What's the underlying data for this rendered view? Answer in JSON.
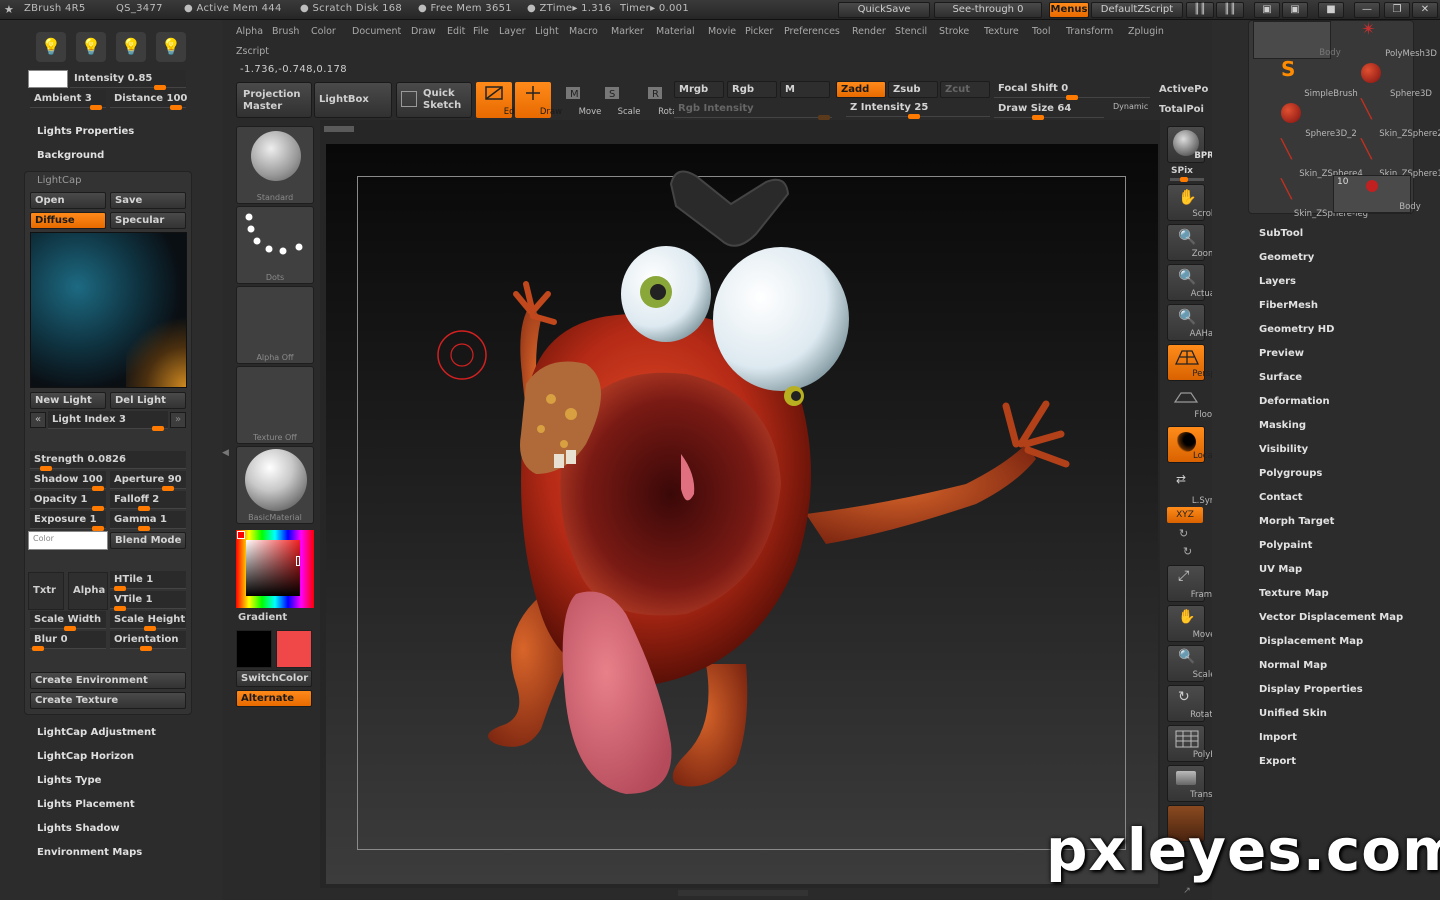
{
  "titlebar": {
    "app": "ZBrush 4R5",
    "project": "QS_3477",
    "active_mem": "● Active Mem 444",
    "scratch_disk": "● Scratch Disk 168",
    "free_mem": "● Free Mem 3651",
    "ztime": "● ZTime▸ 1.316",
    "timer": "Timer▸ 0.001",
    "quicksave": "QuickSave",
    "see_through": "See-through  0",
    "menus": "Menus",
    "default_zscript": "DefaultZScript"
  },
  "menus": [
    "Alpha",
    "Brush",
    "Color",
    "Document",
    "Draw",
    "Edit",
    "File",
    "Layer",
    "Light",
    "Macro",
    "Marker",
    "Material",
    "Movie",
    "Picker",
    "Preferences",
    "Render",
    "Stencil",
    "Stroke",
    "Texture",
    "Tool",
    "Transform",
    "Zplugin"
  ],
  "zscript_label": "Zscript",
  "coords": "-1.736,-0.748,0.178",
  "toolbar": {
    "projection_master": "Projection Master",
    "lightbox": "LightBox",
    "quick_sketch": "Quick Sketch",
    "edit": "Edit",
    "draw": "Draw",
    "move": "Move",
    "scale": "Scale",
    "rotate": "Rotate",
    "mrgb": "Mrgb",
    "rgb": "Rgb",
    "m": "M",
    "rgb_intensity": "Rgb  Intensity",
    "zadd": "Zadd",
    "zsub": "Zsub",
    "zcut": "Zcut",
    "z_intensity": "Z  Intensity 25",
    "focal_shift": "Focal  Shift 0",
    "draw_size": "Draw  Size 64",
    "dynamic": "Dynamic",
    "active_points": "ActivePo",
    "total_points": "TotalPoi"
  },
  "light_panel": {
    "intensity": "Intensity 0.85",
    "ambient": "Ambient 3",
    "distance": "Distance 100",
    "lights_properties": "Lights Properties",
    "background": "Background",
    "lightcap": "LightCap",
    "open": "Open",
    "save": "Save",
    "diffuse": "Diffuse",
    "specular": "Specular",
    "new_light": "New Light",
    "del_light": "Del Light",
    "light_index": "Light Index 3",
    "strength": "Strength 0.0826",
    "shadow": "Shadow 100",
    "aperture": "Aperture 90",
    "opacity": "Opacity 1",
    "falloff": "Falloff 2",
    "exposure": "Exposure 1",
    "gamma": "Gamma 1",
    "color": "Color",
    "blend_mode": "Blend Mode",
    "txtr": "Txtr",
    "alpha": "Alpha",
    "htile": "HTile 1",
    "vtile": "VTile 1",
    "scale_width": "Scale Width",
    "scale_height": "Scale Height",
    "blur": "Blur 0",
    "orientation": "Orientation",
    "create_environment": "Create Environment",
    "create_texture": "Create Texture",
    "subpalettes": [
      "LightCap Adjustment",
      "LightCap Horizon",
      "Lights Type",
      "Lights Placement",
      "Lights Shadow",
      "Environment Maps"
    ]
  },
  "midcol": {
    "standard": "Standard",
    "dots": "Dots",
    "alpha_off": "Alpha  Off",
    "texture_off": "Texture  Off",
    "basic_material": "BasicMaterial",
    "gradient": "Gradient",
    "switch_color": "SwitchColor",
    "alternate": "Alternate"
  },
  "right_tools": [
    "BPR",
    "SPix",
    "Scroll",
    "Zoom",
    "Actual",
    "AAHalf",
    "Persp",
    "Floor",
    "Local",
    "L.Sym",
    "XYZ",
    "Frame",
    "Move",
    "Scale",
    "Rotate",
    "PolyF",
    "Transp"
  ],
  "subtools": {
    "body_top": "Body",
    "polymesh3d": "PolyMesh3D",
    "simplebrush": "SimpleBrush",
    "sphere3d": "Sphere3D",
    "sphere3d_2": "Sphere3D_2",
    "skin_zsphere2": "Skin_ZSphere2",
    "skin_zsphere4": "Skin_ZSphere4",
    "skin_zsphere1": "Skin_ZSphere1",
    "skin_zsphere_leg": "Skin_ZSphere-leg",
    "body": "Body",
    "body_count": "10"
  },
  "tool_menu": [
    "SubTool",
    "Geometry",
    "Layers",
    "FiberMesh",
    "Geometry HD",
    "Preview",
    "Surface",
    "Deformation",
    "Masking",
    "Visibility",
    "Polygroups",
    "Contact",
    "Morph Target",
    "Polypaint",
    "UV Map",
    "Texture Map",
    "Vector Displacement Map",
    "Displacement Map",
    "Normal Map",
    "Display Properties",
    "Unified Skin",
    "Import",
    "Export"
  ],
  "watermark": "pxleyes.com",
  "colors": {
    "accent": "#ff7a00",
    "main_color": "#000000",
    "secondary_color": "#f04848"
  }
}
